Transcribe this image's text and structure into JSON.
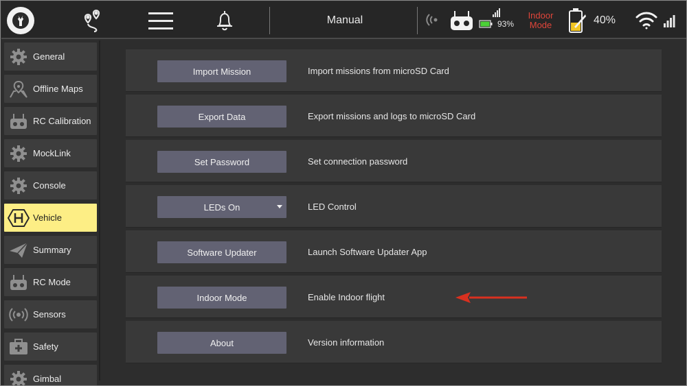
{
  "topbar": {
    "flight_mode": "Manual",
    "rc_signal_percent": "93%",
    "indoor_mode_line1": "Indoor",
    "indoor_mode_line2": "Mode",
    "battery_percent": "40%",
    "icons": [
      "logo-icon",
      "waypoint-map-icon",
      "hamburger-menu-icon",
      "bell-icon",
      "broadcast-icon",
      "rc-controller-icon",
      "battery-icon",
      "drone-battery-icon",
      "wifi-icon",
      "signal-bars-icon"
    ]
  },
  "sidebar": {
    "items": [
      {
        "label": "General",
        "icon": "gear-icon"
      },
      {
        "label": "Offline Maps",
        "icon": "map-pin-icon"
      },
      {
        "label": "RC Calibration",
        "icon": "rc-controller-icon"
      },
      {
        "label": "MockLink",
        "icon": "gear-icon"
      },
      {
        "label": "Console",
        "icon": "gear-icon"
      },
      {
        "label": "Vehicle",
        "icon": "hexagon-h-icon",
        "active": true
      },
      {
        "label": "Summary",
        "icon": "paper-plane-icon"
      },
      {
        "label": "RC Mode",
        "icon": "rc-controller-icon"
      },
      {
        "label": "Sensors",
        "icon": "broadcast-icon"
      },
      {
        "label": "Safety",
        "icon": "first-aid-kit-icon"
      },
      {
        "label": "Gimbal",
        "icon": "gear-icon"
      }
    ]
  },
  "main": {
    "rows": [
      {
        "button": "Import Mission",
        "description": "Import missions from microSD Card"
      },
      {
        "button": "Export Data",
        "description": "Export missions and logs to microSD Card"
      },
      {
        "button": "Set Password",
        "description": "Set connection password"
      },
      {
        "button": "LEDs On",
        "description": "LED Control",
        "dropdown": true
      },
      {
        "button": "Software Updater",
        "description": "Launch Software Updater App"
      },
      {
        "button": "Indoor Mode",
        "description": "Enable Indoor flight"
      },
      {
        "button": "About",
        "description": "Version information"
      }
    ]
  },
  "colors": {
    "active_item": "#fdee85",
    "button": "#626273",
    "indoor_text": "#e0453a",
    "arrow": "#d9301f",
    "battery_green": "#4cd137",
    "battery_yellow": "#f3c623"
  }
}
